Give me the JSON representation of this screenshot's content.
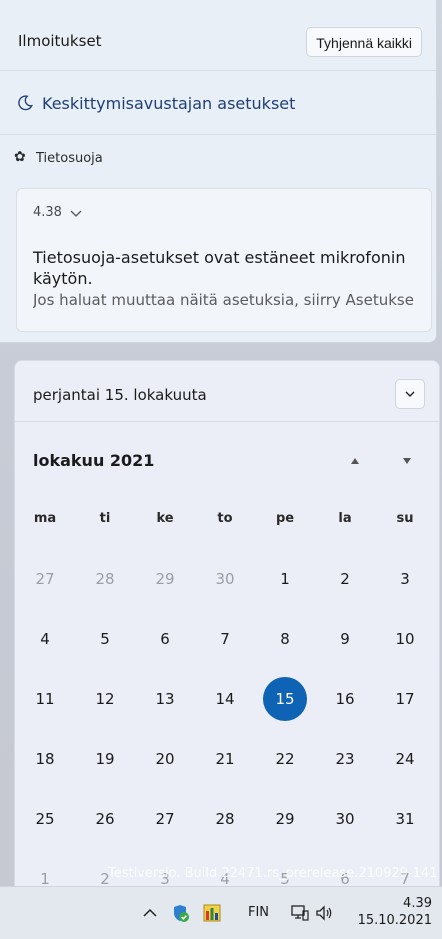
{
  "notifications": {
    "title": "Ilmoitukset",
    "clear_all": "Tyhjennä kaikki",
    "focus_assist_settings": "Keskittymisavustajan asetukset",
    "group_name": "Tietosuoja",
    "card": {
      "time": "4.38",
      "title": "Tietosuoja-asetukset ovat estäneet mikrofonin käytön.",
      "body": "Jos haluat muuttaa näitä asetuksia, siirry Asetukse"
    }
  },
  "calendar": {
    "date_label": "perjantai 15. lokakuuta",
    "month_label": "lokakuu 2021",
    "weekdays": [
      "ma",
      "ti",
      "ke",
      "to",
      "pe",
      "la",
      "su"
    ],
    "weeks": [
      [
        "27",
        "28",
        "29",
        "30",
        "1",
        "2",
        "3"
      ],
      [
        "4",
        "5",
        "6",
        "7",
        "8",
        "9",
        "10"
      ],
      [
        "11",
        "12",
        "13",
        "14",
        "15",
        "16",
        "17"
      ],
      [
        "18",
        "19",
        "20",
        "21",
        "22",
        "23",
        "24"
      ],
      [
        "25",
        "26",
        "27",
        "28",
        "29",
        "30",
        "31"
      ],
      [
        "1",
        "2",
        "3",
        "4",
        "5",
        "6",
        "7"
      ]
    ],
    "today": "15",
    "accent_color": "#0f63b4"
  },
  "watermark": "Testiversio. Build 22471.rs_prerelease.210929-141",
  "taskbar": {
    "language": "FIN",
    "time": "4.39",
    "date": "15.10.2021",
    "icons": [
      "chevron-up-icon",
      "security-icon",
      "task-manager-icon",
      "network-icon",
      "volume-icon"
    ]
  }
}
